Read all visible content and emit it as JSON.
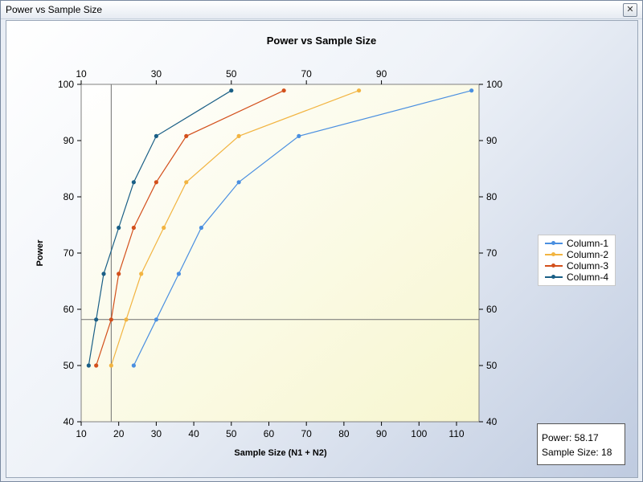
{
  "window": {
    "title": "Power vs Sample Size",
    "close_glyph": "✕"
  },
  "info": {
    "power_text": "Power: 58.17",
    "sample_size_text": "Sample Size: 18"
  },
  "colors": {
    "plot_bg_start": "#ffffff",
    "plot_bg_end": "#f7f6cf",
    "Column-1": "#4a8fe0",
    "Column-2": "#f2b441",
    "Column-3": "#d3501c",
    "Column-4": "#1a5f86"
  },
  "chart_data": {
    "type": "line",
    "title": "Power vs Sample Size",
    "xlabel": "Sample Size (N1 + N2)",
    "ylabel": "Power",
    "xlim": [
      10,
      116
    ],
    "ylim": [
      40,
      100
    ],
    "x_ticks_bottom": [
      10,
      20,
      30,
      40,
      50,
      60,
      70,
      80,
      90,
      100,
      110
    ],
    "x_ticks_top": [
      10,
      30,
      50,
      70,
      90
    ],
    "y_ticks": [
      40,
      50,
      60,
      70,
      80,
      90,
      100
    ],
    "grid": false,
    "legend_position": "right",
    "crosshair": {
      "x": 18,
      "y": 58.17
    },
    "series": [
      {
        "name": "Column-1",
        "color": "#4a8fe0",
        "points": [
          [
            24,
            50
          ],
          [
            30,
            58.17
          ],
          [
            36,
            66.3
          ],
          [
            42,
            74.5
          ],
          [
            52,
            82.6
          ],
          [
            68,
            90.8
          ],
          [
            114,
            98.9
          ]
        ]
      },
      {
        "name": "Column-2",
        "color": "#f2b441",
        "points": [
          [
            18,
            50
          ],
          [
            22,
            58.17
          ],
          [
            26,
            66.3
          ],
          [
            32,
            74.5
          ],
          [
            38,
            82.6
          ],
          [
            52,
            90.8
          ],
          [
            84,
            98.9
          ]
        ]
      },
      {
        "name": "Column-3",
        "color": "#d3501c",
        "points": [
          [
            14,
            50
          ],
          [
            18,
            58.17
          ],
          [
            20,
            66.3
          ],
          [
            24,
            74.5
          ],
          [
            30,
            82.6
          ],
          [
            38,
            90.8
          ],
          [
            64,
            98.9
          ]
        ]
      },
      {
        "name": "Column-4",
        "color": "#1a5f86",
        "points": [
          [
            12,
            50
          ],
          [
            14,
            58.17
          ],
          [
            16,
            66.3
          ],
          [
            20,
            74.5
          ],
          [
            24,
            82.6
          ],
          [
            30,
            90.8
          ],
          [
            50,
            98.9
          ]
        ]
      }
    ]
  }
}
